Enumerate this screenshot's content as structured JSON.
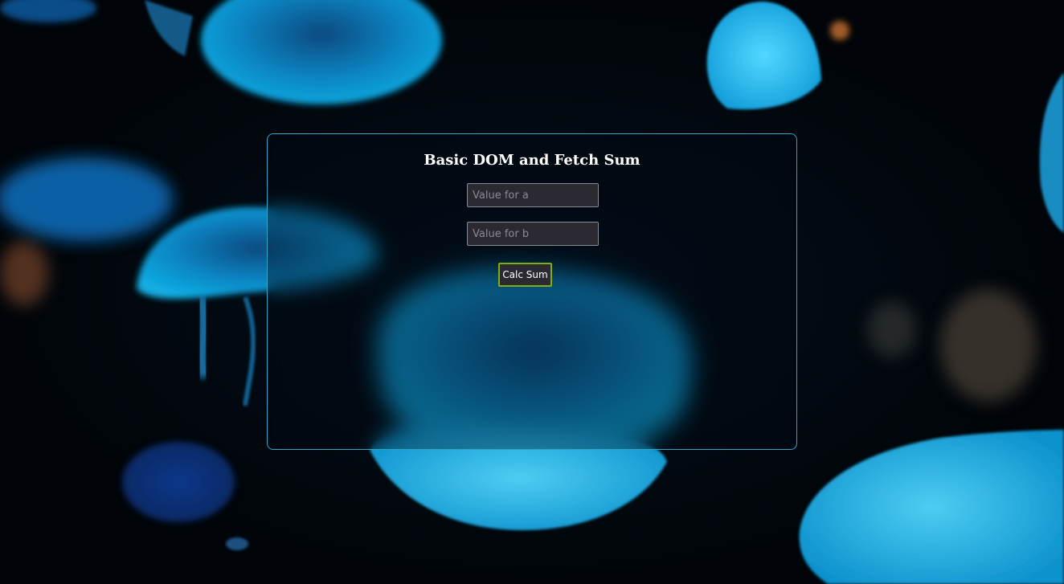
{
  "page": {
    "title": "Basic DOM and Fetch Sum"
  },
  "form": {
    "input_a": {
      "value": "",
      "placeholder": "Value for a"
    },
    "input_b": {
      "value": "",
      "placeholder": "Value for b"
    },
    "calc_button_label": "Calc Sum"
  },
  "colors": {
    "panel_border": "#2fa6c8",
    "button_border": "#7fae12",
    "field_background": "#2b2a33",
    "jellyfish_glow": "#1fb4ea"
  }
}
